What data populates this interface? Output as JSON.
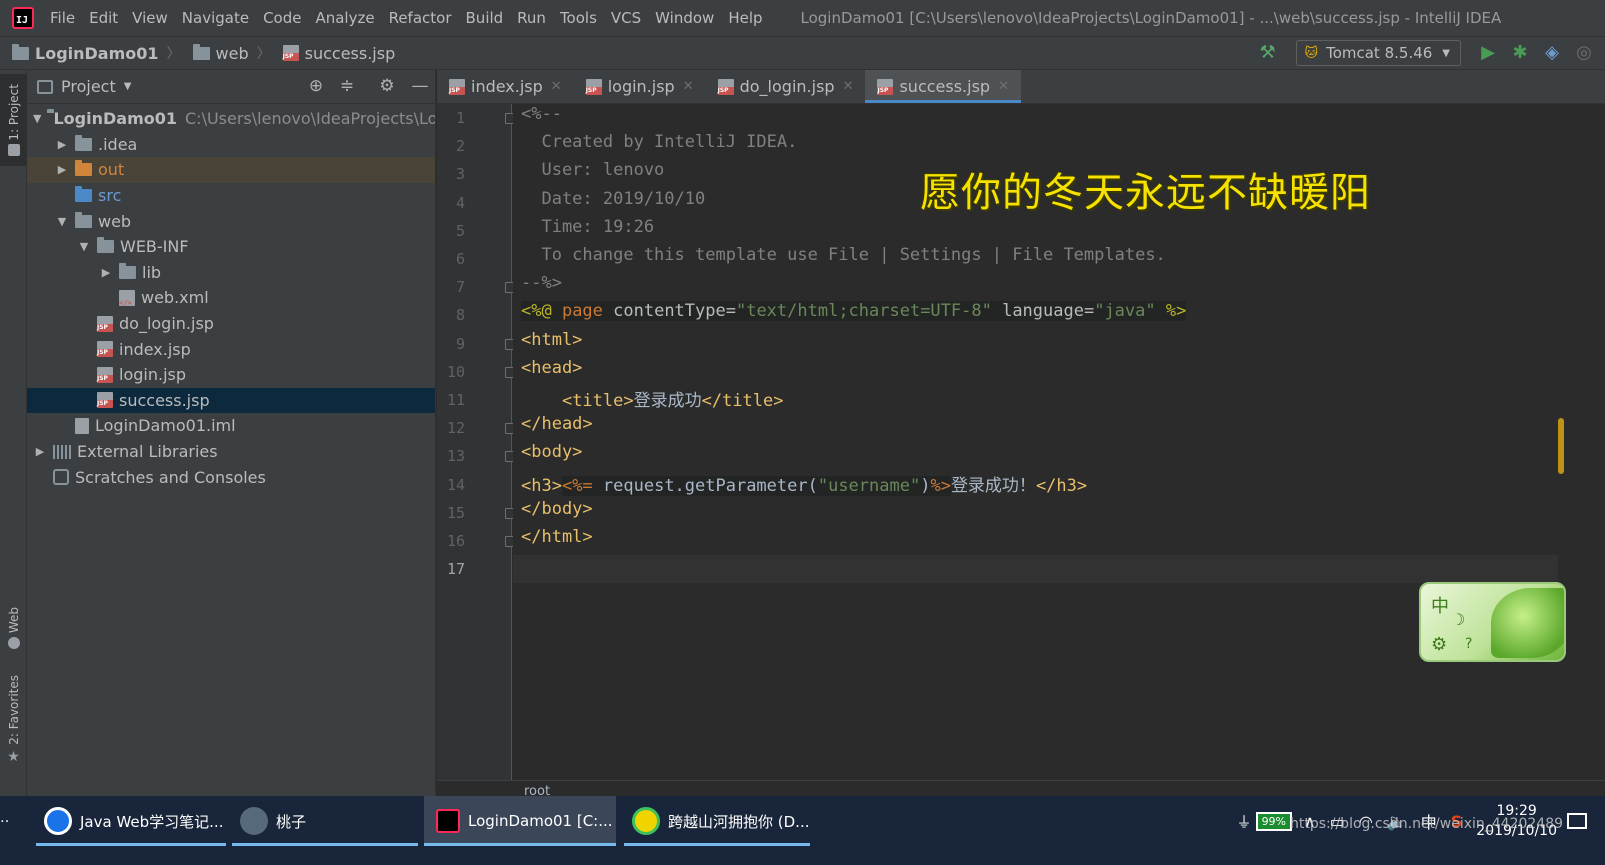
{
  "menubar": {
    "app_icon": "IJ",
    "items": [
      "File",
      "Edit",
      "View",
      "Navigate",
      "Code",
      "Analyze",
      "Refactor",
      "Build",
      "Run",
      "Tools",
      "VCS",
      "Window",
      "Help"
    ],
    "window_title": "LoginDamo01 [C:\\Users\\lenovo\\IdeaProjects\\LoginDamo01] - ...\\web\\success.jsp - IntelliJ IDEA"
  },
  "navbar": {
    "crumbs": [
      "LoginDamo01",
      "web",
      "success.jsp"
    ],
    "run_config": "Tomcat 8.5.46",
    "icons": [
      "hammer-icon",
      "run-icon",
      "debug-icon",
      "coverage-icon",
      "profile-icon"
    ]
  },
  "left_strip": {
    "project_tab": "1: Project",
    "web_tab": "Web",
    "favorites_tab": "2: Favorites"
  },
  "project_panel": {
    "title": "Project",
    "tree": [
      {
        "label": "LoginDamo01",
        "hint": "C:\\Users\\lenovo\\IdeaProjects\\Logir",
        "icon": "module-folder-icon",
        "indent": 0,
        "arrow": "open"
      },
      {
        "label": ".idea",
        "icon": "folder-icon",
        "indent": 1,
        "arrow": "closed"
      },
      {
        "label": "out",
        "icon": "excluded-folder-icon",
        "indent": 1,
        "arrow": "closed"
      },
      {
        "label": "src",
        "icon": "source-folder-icon",
        "indent": 1,
        "arrow": "none"
      },
      {
        "label": "web",
        "icon": "web-folder-icon",
        "indent": 1,
        "arrow": "open"
      },
      {
        "label": "WEB-INF",
        "icon": "folder-icon",
        "indent": 2,
        "arrow": "open"
      },
      {
        "label": "lib",
        "icon": "folder-icon",
        "indent": 3,
        "arrow": "closed"
      },
      {
        "label": "web.xml",
        "icon": "xml-file-icon",
        "indent": 3,
        "arrow": "none"
      },
      {
        "label": "do_login.jsp",
        "icon": "jsp-file-icon",
        "indent": 2,
        "arrow": "none"
      },
      {
        "label": "index.jsp",
        "icon": "jsp-file-icon",
        "indent": 2,
        "arrow": "none"
      },
      {
        "label": "login.jsp",
        "icon": "jsp-file-icon",
        "indent": 2,
        "arrow": "none"
      },
      {
        "label": "success.jsp",
        "icon": "jsp-file-icon",
        "indent": 2,
        "arrow": "none"
      },
      {
        "label": "LoginDamo01.iml",
        "icon": "iml-file-icon",
        "indent": 1,
        "arrow": "none"
      },
      {
        "label": "External Libraries",
        "icon": "library-icon",
        "indent": 0,
        "arrow": "closed"
      },
      {
        "label": "Scratches and Consoles",
        "icon": "scratch-icon",
        "indent": 0,
        "arrow": "none"
      }
    ]
  },
  "tabs": [
    {
      "label": "index.jsp",
      "active": false
    },
    {
      "label": "login.jsp",
      "active": false
    },
    {
      "label": "do_login.jsp",
      "active": false
    },
    {
      "label": "success.jsp",
      "active": true
    }
  ],
  "editor": {
    "line_numbers": [
      "1",
      "2",
      "3",
      "4",
      "5",
      "6",
      "7",
      "8",
      "9",
      "10",
      "11",
      "12",
      "13",
      "14",
      "15",
      "16",
      "17"
    ],
    "current_line": 17,
    "lines": [
      [
        [
          "c-comment",
          "<%--"
        ]
      ],
      [
        [
          "c-comment",
          "  Created by IntelliJ IDEA."
        ]
      ],
      [
        [
          "c-comment",
          "  User: lenovo"
        ]
      ],
      [
        [
          "c-comment",
          "  Date: 2019/10/10"
        ]
      ],
      [
        [
          "c-comment",
          "  Time: 19:26"
        ]
      ],
      [
        [
          "c-comment",
          "  To change this template use File | Settings | File Templates."
        ]
      ],
      [
        [
          "c-comment",
          "--%>"
        ]
      ],
      [
        [
          "c-dir c-bg",
          "<%@ "
        ],
        [
          "c-kw c-bg",
          "page "
        ],
        [
          "c-attr c-bg",
          "contentType="
        ],
        [
          "c-str c-bg",
          "\"text/html;charset=UTF-8\" "
        ],
        [
          "c-attr c-bg",
          "language="
        ],
        [
          "c-str c-bg",
          "\"java\" "
        ],
        [
          "c-dir c-bg",
          "%>"
        ]
      ],
      [
        [
          "c-tag",
          "<html>"
        ]
      ],
      [
        [
          "c-tag",
          "<head>"
        ]
      ],
      [
        [
          "c-text",
          "    "
        ],
        [
          "c-tag",
          "<title>"
        ],
        [
          "c-text",
          "登录成功"
        ],
        [
          "c-tag",
          "</title>"
        ]
      ],
      [
        [
          "c-tag",
          "</head>"
        ]
      ],
      [
        [
          "c-tag",
          "<body>"
        ]
      ],
      [
        [
          "c-tag",
          "<h3>"
        ],
        [
          "c-kw c-scr",
          "<%= "
        ],
        [
          "c-text c-scr",
          "request.getParameter("
        ],
        [
          "c-str c-scr",
          "\"username\""
        ],
        [
          "c-text c-scr",
          ")"
        ],
        [
          "c-kw c-scr",
          "%>"
        ],
        [
          "c-text",
          "登录成功！"
        ],
        [
          "c-tag",
          "</h3>"
        ]
      ],
      [
        [
          "c-tag",
          "</body>"
        ]
      ],
      [
        [
          "c-tag",
          "</html>"
        ]
      ],
      [
        [
          "c-text",
          ""
        ]
      ]
    ],
    "breadcrumb": "root"
  },
  "caption": "愿你的冬天永远不缺暖阳",
  "ime_widget": {
    "mode_char": "中"
  },
  "taskbar": {
    "tasks": [
      {
        "label": "Java Web学习笔记...",
        "icon": "browser-icon"
      },
      {
        "label": "桃子",
        "icon": "avatar-icon"
      },
      {
        "label": "LoginDamo01 [C:...",
        "icon": "intellij-icon"
      },
      {
        "label": "跨越山河拥抱你 (D...",
        "icon": "music-player-icon"
      }
    ],
    "battery": "99%",
    "ime_tray": "中",
    "time": "19:29",
    "date": "2019/10/10",
    "watermark": "https://blog.csdn.net/weixin_44202489"
  },
  "colors": {
    "bg_editor": "#2b2b2b",
    "bg_panel": "#3c3f41",
    "accent_tab": "#4a88c7",
    "selection": "#0d293e",
    "caption": "#f6e100"
  }
}
